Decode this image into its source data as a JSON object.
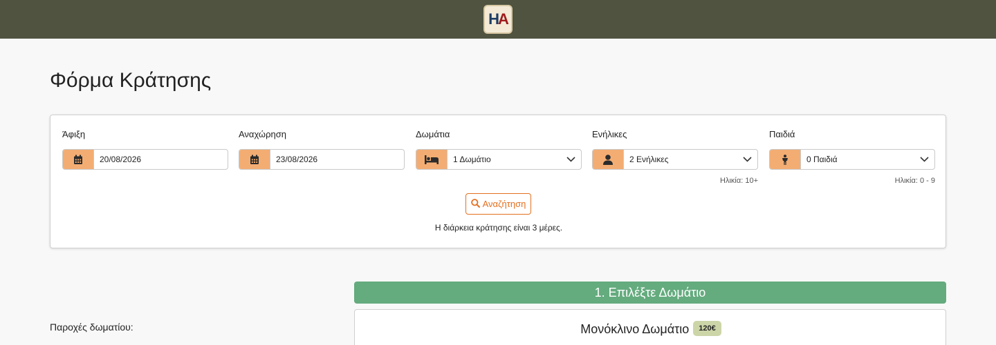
{
  "header": {
    "logo_text_h": "H",
    "logo_text_a": "A",
    "bar_color": "#4f5340"
  },
  "page_title": "Φόρμα Κράτησης",
  "form": {
    "arrival": {
      "label": "Άφιξη",
      "value": "20/08/2026",
      "icon": "calendar-icon"
    },
    "departure": {
      "label": "Αναχώρηση",
      "value": "23/08/2026",
      "icon": "calendar-icon"
    },
    "rooms": {
      "label": "Δωμάτια",
      "value": "1 Δωμάτιο",
      "icon": "bed-icon"
    },
    "adults": {
      "label": "Ενήλικες",
      "value": "2 Ενήλικες",
      "icon": "user-icon",
      "hint": "Ηλικία: 10+"
    },
    "children": {
      "label": "Παιδιά",
      "value": "0 Παιδιά",
      "icon": "child-icon",
      "hint": "Ηλικία: 0 - 9"
    },
    "search_label": "Αναζήτηση",
    "duration_text": "Η διάρκεια κράτησης είναι 3 μέρες."
  },
  "amenities_label": "Παροχές δωματίου:",
  "step": {
    "title": "1. Επιλέξτε Δωμάτιο",
    "color": "#64ab7e"
  },
  "room": {
    "name": "Μονόκλινο Δωμάτιο",
    "price": "120€"
  },
  "colors": {
    "accent": "#f3ad73",
    "search": "#e36f1e"
  }
}
